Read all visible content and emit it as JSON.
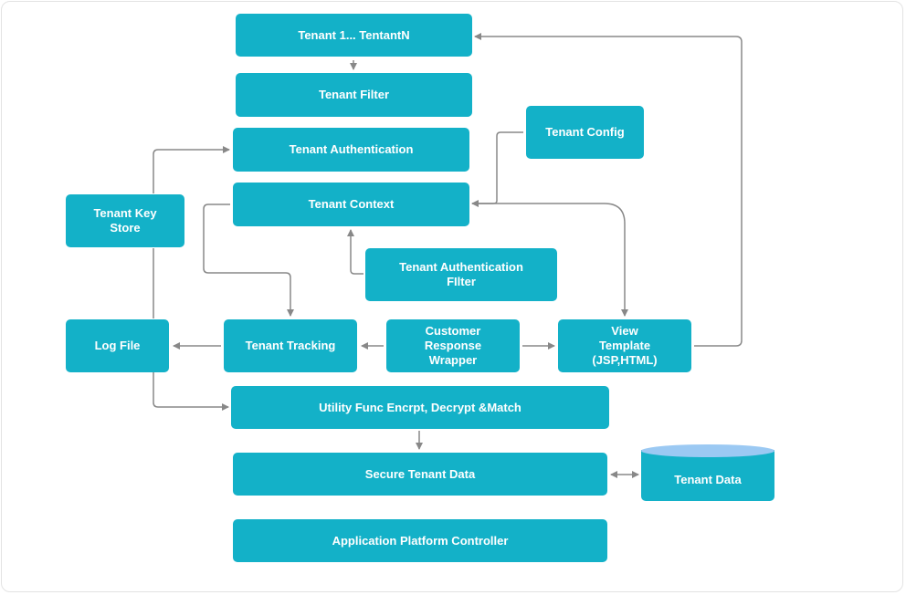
{
  "diagram": {
    "nodes": {
      "tenants": "Tenant 1... TentantN",
      "tenant_filter": "Tenant Filter",
      "tenant_authentication": "Tenant Authentication",
      "tenant_config": "Tenant Config",
      "tenant_context": "Tenant Context",
      "tenant_key_store": "Tenant Key\nStore",
      "tenant_authentication_filter": "Tenant Authentication\nFIlter",
      "log_file": "Log File",
      "tenant_tracking": "Tenant Tracking",
      "customer_response_wrapper": "Customer\nResponse\nWrapper",
      "view_template": "View\nTemplate\n(JSP,HTML)",
      "utility_func": "Utility Func Encrpt, Decrypt &Match",
      "secure_tenant_data": "Secure Tenant Data",
      "tenant_data": "Tenant Data",
      "application_platform_controller": "Application Platform Controller"
    },
    "edges": [
      {
        "from": "tenants",
        "to": "tenant_filter"
      },
      {
        "from": "tenant_config",
        "to": "tenant_context"
      },
      {
        "from": "view_template",
        "to": "tenants"
      },
      {
        "from": "tenant_key_store",
        "to": "tenant_authentication"
      },
      {
        "from": "tenant_context",
        "to": "tenant_tracking"
      },
      {
        "from": "tenant_context",
        "to": "view_template"
      },
      {
        "from": "tenant_authentication_filter",
        "to": "tenant_context"
      },
      {
        "from": "tenant_tracking",
        "to": "log_file"
      },
      {
        "from": "customer_response_wrapper",
        "to": "tenant_tracking"
      },
      {
        "from": "customer_response_wrapper",
        "to": "view_template"
      },
      {
        "from": "log_file",
        "to": "utility_func"
      },
      {
        "from": "utility_func",
        "to": "secure_tenant_data"
      },
      {
        "from": "secure_tenant_data",
        "to": "tenant_data",
        "bidirectional": true
      }
    ],
    "colors": {
      "node_fill": "#13b1c8",
      "node_text": "#ffffff",
      "edge": "#888888",
      "database_cap": "#9bc9f3"
    }
  }
}
